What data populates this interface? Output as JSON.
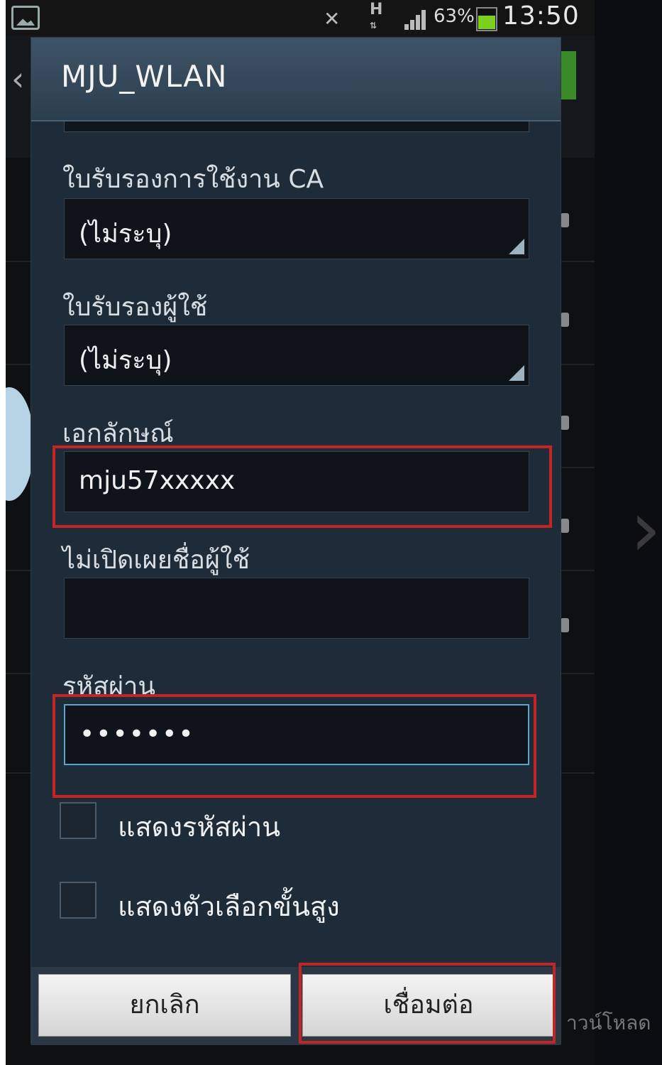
{
  "status_bar": {
    "battery_percent": "63%",
    "time": "13:50",
    "network_label": "H"
  },
  "dialog": {
    "title": "MJU_WLAN",
    "fields": {
      "ca_certificate": {
        "label": "ใบรับรองการใช้งาน CA",
        "value": "(ไม่ระบุ)"
      },
      "user_certificate": {
        "label": "ใบรับรองผู้ใช้",
        "value": "(ไม่ระบุ)"
      },
      "identity": {
        "label": "เอกลักษณ์",
        "value": "mju57xxxxx"
      },
      "anonymous_identity": {
        "label": "ไม่เปิดเผยชื่อผู้ใช้",
        "value": ""
      },
      "password": {
        "label": "รหัสผ่าน",
        "value": "•••••••"
      }
    },
    "checkboxes": {
      "show_password": "แสดงรหัสผ่าน",
      "show_advanced": "แสดงตัวเลือกขั้นสูง"
    },
    "buttons": {
      "cancel": "ยกเลิก",
      "connect": "เชื่อมต่อ"
    }
  },
  "background": {
    "bottom_partial_text": "าวน์โหลด"
  },
  "colors": {
    "highlight": "#c42424",
    "dialog_bg": "#1e2b38",
    "focus": "#5fa3c8"
  }
}
